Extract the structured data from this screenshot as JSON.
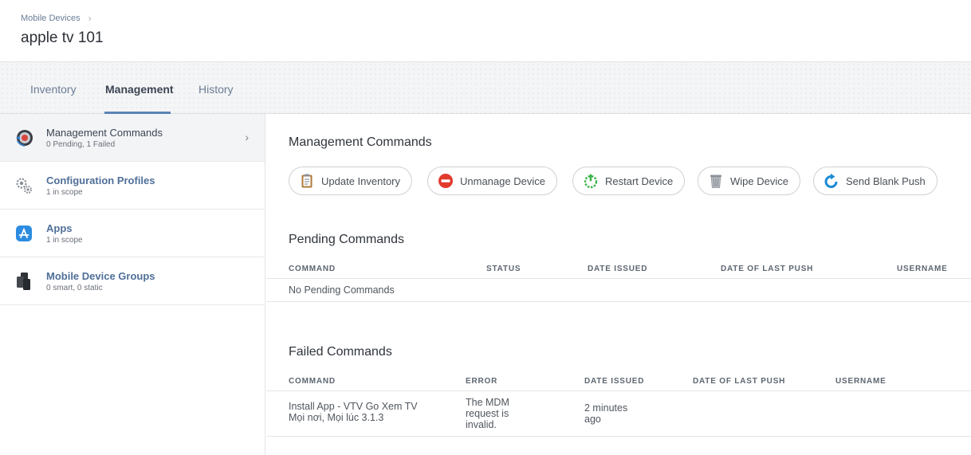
{
  "header": {
    "breadcrumb": "Mobile Devices",
    "breadcrumb_sep": "›",
    "title": "apple tv 101"
  },
  "tabs": [
    {
      "label": "Inventory",
      "active": false
    },
    {
      "label": "Management",
      "active": true
    },
    {
      "label": "History",
      "active": false
    }
  ],
  "sidebar": {
    "items": [
      {
        "title": "Management Commands",
        "subtitle": "0 Pending, 1 Failed",
        "icon": "management-commands-icon",
        "active": true
      },
      {
        "title": "Configuration Profiles",
        "subtitle": "1 in scope",
        "icon": "gears-icon",
        "active": false
      },
      {
        "title": "Apps",
        "subtitle": "1 in scope",
        "icon": "app-store-icon",
        "active": false
      },
      {
        "title": "Mobile Device Groups",
        "subtitle": "0 smart, 0 static",
        "icon": "device-groups-icon",
        "active": false
      }
    ],
    "chevron": "›"
  },
  "management": {
    "title": "Management Commands",
    "buttons": [
      {
        "label": "Update Inventory",
        "icon": "clipboard-icon"
      },
      {
        "label": "Unmanage Device",
        "icon": "no-entry-icon"
      },
      {
        "label": "Restart Device",
        "icon": "power-icon"
      },
      {
        "label": "Wipe Device",
        "icon": "trash-icon"
      },
      {
        "label": "Send Blank Push",
        "icon": "refresh-icon"
      }
    ]
  },
  "pending": {
    "title": "Pending Commands",
    "columns": [
      "COMMAND",
      "STATUS",
      "DATE ISSUED",
      "DATE OF LAST PUSH",
      "USERNAME"
    ],
    "empty_text": "No Pending Commands"
  },
  "failed": {
    "title": "Failed Commands",
    "columns": [
      "COMMAND",
      "ERROR",
      "DATE ISSUED",
      "DATE OF LAST PUSH",
      "USERNAME"
    ],
    "rows": [
      {
        "command": "Install App - VTV Go Xem TV Mọi nơi, Mọi lúc 3.1.3",
        "error": "The MDM request is invalid.",
        "date_issued": "2 minutes ago",
        "date_last_push": "",
        "username": ""
      }
    ]
  },
  "colors": {
    "accent": "#5a84b5",
    "link": "#4f6f98",
    "unmanage_red": "#e23b2e",
    "restart_green": "#3bb54a",
    "push_blue": "#1b8ad3"
  }
}
